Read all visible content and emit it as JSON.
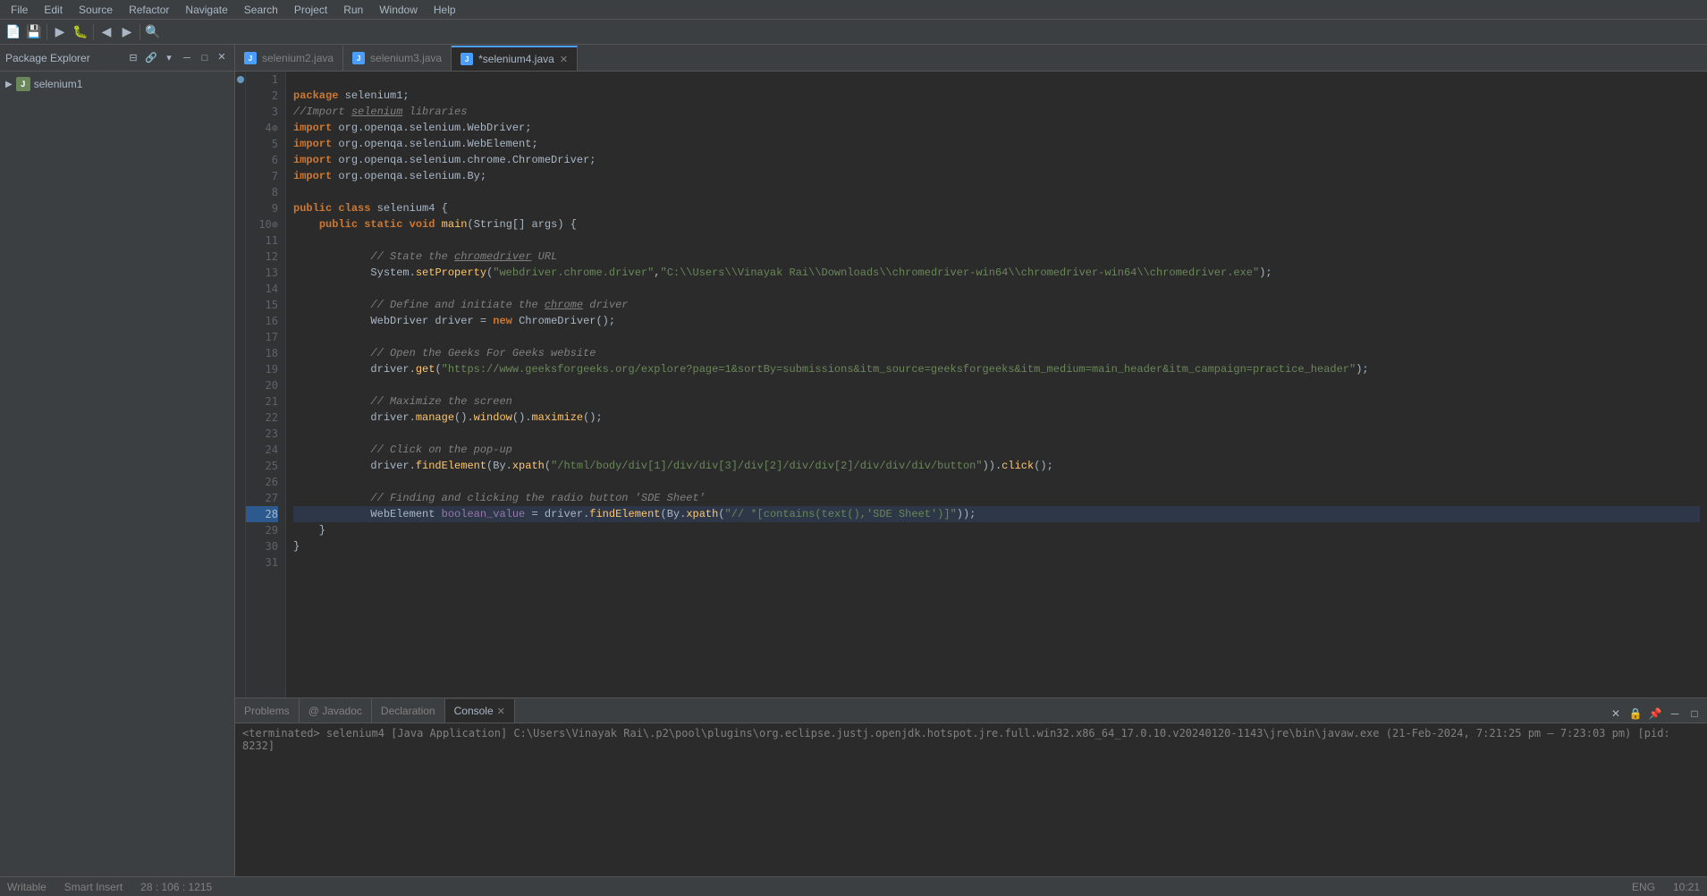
{
  "menubar": {
    "items": [
      "File",
      "Edit",
      "Source",
      "Refactor",
      "Navigate",
      "Search",
      "Project",
      "Run",
      "Window",
      "Help"
    ]
  },
  "packageExplorer": {
    "title": "Package Explorer",
    "project": "selenium1"
  },
  "tabs": [
    {
      "label": "selenium2.java",
      "active": false,
      "modified": false
    },
    {
      "label": "selenium3.java",
      "active": false,
      "modified": false
    },
    {
      "label": "*selenium4.java",
      "active": true,
      "modified": true
    }
  ],
  "bottomTabs": [
    {
      "label": "Problems",
      "active": false
    },
    {
      "label": "Javadoc",
      "active": false
    },
    {
      "label": "Declaration",
      "active": false
    },
    {
      "label": "Console",
      "active": true
    }
  ],
  "console": {
    "terminated_text": "<terminated> selenium4 [Java Application] C:\\Users\\Vinayak Rai\\.p2\\pool\\plugins\\org.eclipse.justj.openjdk.hotspot.jre.full.win32.x86_64_17.0.10.v20240120-1143\\jre\\bin\\javaw.exe  (21-Feb-2024, 7:21:25 pm – 7:23:03 pm) [pid: 8232]"
  },
  "statusBar": {
    "writable": "Writable",
    "insertMode": "Smart Insert",
    "position": "28 : 106 : 1215",
    "language": "ENG",
    "time": "10:21"
  },
  "code": {
    "lines": [
      {
        "num": 1,
        "content": ""
      },
      {
        "num": 2,
        "content": "package selenium1;"
      },
      {
        "num": 3,
        "content": "//Import selenium libraries"
      },
      {
        "num": 4,
        "content": "import org.openqa.selenium.WebDriver;"
      },
      {
        "num": 5,
        "content": "import org.openqa.selenium.WebElement;"
      },
      {
        "num": 6,
        "content": "import org.openqa.selenium.chrome.ChromeDriver;"
      },
      {
        "num": 7,
        "content": "import org.openqa.selenium.By;"
      },
      {
        "num": 8,
        "content": ""
      },
      {
        "num": 9,
        "content": "public class selenium4 {"
      },
      {
        "num": 10,
        "content": "    public static void main(String[] args) {"
      },
      {
        "num": 11,
        "content": ""
      },
      {
        "num": 12,
        "content": "            // State the chromedriver URL"
      },
      {
        "num": 13,
        "content": "            System.setProperty(\"webdriver.chrome.driver\",\"C:\\\\Users\\\\Vinayak Rai\\\\Downloads\\\\chromedriver-win64\\\\chromedriver-win64\\\\chromedriver.exe\");"
      },
      {
        "num": 14,
        "content": ""
      },
      {
        "num": 15,
        "content": "            // Define and initiate the chrome driver"
      },
      {
        "num": 16,
        "content": "            WebDriver driver = new ChromeDriver();"
      },
      {
        "num": 17,
        "content": ""
      },
      {
        "num": 18,
        "content": "            // Open the Geeks For Geeks website"
      },
      {
        "num": 19,
        "content": "            driver.get(\"https://www.geeksforgeeks.org/explore?page=1&sortBy=submissions&itm_source=geeksforgeeks&itm_medium=main_header&itm_campaign=practice_header\");"
      },
      {
        "num": 20,
        "content": ""
      },
      {
        "num": 21,
        "content": "            // Maximize the screen"
      },
      {
        "num": 22,
        "content": "            driver.manage().window().maximize();"
      },
      {
        "num": 23,
        "content": ""
      },
      {
        "num": 24,
        "content": "            // Click on the pop-up"
      },
      {
        "num": 25,
        "content": "            driver.findElement(By.xpath(\"/html/body/div[1]/div/div[3]/div[2]/div/div[2]/div/div/div/button\")).click();"
      },
      {
        "num": 26,
        "content": ""
      },
      {
        "num": 27,
        "content": "            // Finding and clicking the radio button 'SDE Sheet'"
      },
      {
        "num": 28,
        "content": "            WebElement boolean_value = driver.findElement(By.xpath(\"// *[contains(text(),'SDE Sheet')]\"));"
      },
      {
        "num": 29,
        "content": "    }"
      },
      {
        "num": 30,
        "content": "}"
      },
      {
        "num": 31,
        "content": ""
      }
    ]
  }
}
